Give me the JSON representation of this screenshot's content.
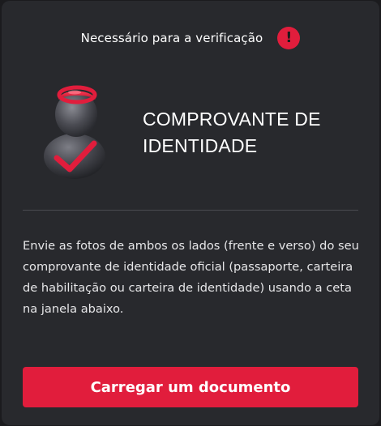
{
  "header": {
    "text": "Necessário para a verificação",
    "alert_icon": "exclamation-icon",
    "alert_glyph": "!"
  },
  "document": {
    "icon": "user-check-icon",
    "title": "COMPROVANTE DE IDENTIDADE"
  },
  "description": "Envie as fotos de ambos os lados (frente e verso) do seu comprovante de identidade oficial (passaporte, carteira de habilitação ou carteira de identidade) usando a ceta na janela abaixo.",
  "upload_button": {
    "label": "Carregar um documento"
  },
  "colors": {
    "accent": "#e11d3c",
    "card_background": "#28292d",
    "text": "#ffffff"
  }
}
